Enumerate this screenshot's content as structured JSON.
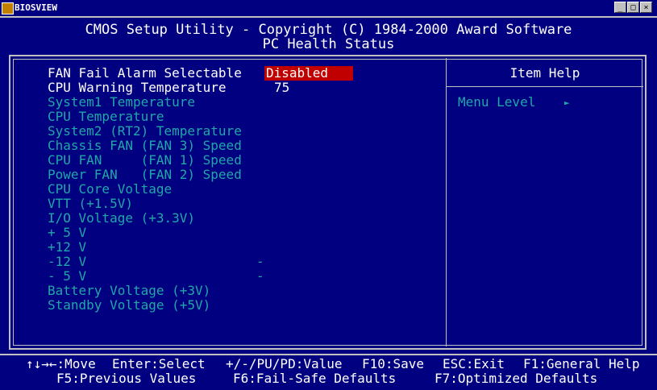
{
  "window": {
    "title": "BIOSVIEW",
    "buttons": [
      "_",
      "□",
      "×"
    ]
  },
  "header": {
    "line1": "CMOS Setup Utility - Copyright (C) 1984-2000 Award Software",
    "line2": "PC Health Status"
  },
  "settings": {
    "fan_fail_alarm": {
      "label": "FAN Fail Alarm Selectable",
      "value": "Disabled"
    },
    "cpu_warning": {
      "label": "CPU Warning Temperature",
      "value": "75"
    }
  },
  "readouts": [
    "System1 Temperature",
    "CPU Temperature",
    "System2 (RT2) Temperature",
    "Chassis FAN (FAN 3) Speed",
    "CPU FAN     (FAN 1) Speed",
    "Power FAN   (FAN 2) Speed",
    "CPU Core Voltage",
    "VTT (+1.5V)",
    "I/O Voltage (+3.3V)",
    "+ 5 V",
    "+12 V",
    "-12 V",
    "- 5 V",
    "Battery Voltage (+3V)",
    "Standby Voltage (+5V)"
  ],
  "readout_dashes": {
    "neg12": "-",
    "neg5": "-"
  },
  "help": {
    "title": "Item Help",
    "menu_level": "Menu Level",
    "arrow": "►"
  },
  "footer": {
    "move": "↑↓→←:Move",
    "select": "Enter:Select",
    "value": "+/-/PU/PD:Value",
    "save": "F10:Save",
    "exit": "ESC:Exit",
    "general_help": "F1:General Help",
    "previous": "F5:Previous Values",
    "failsafe": "F6:Fail-Safe Defaults",
    "optimized": "F7:Optimized Defaults"
  },
  "colors": {
    "background": "#000080",
    "highlight": "#c00000",
    "disabled_text": "#20a8a8",
    "text": "#ffffff"
  }
}
